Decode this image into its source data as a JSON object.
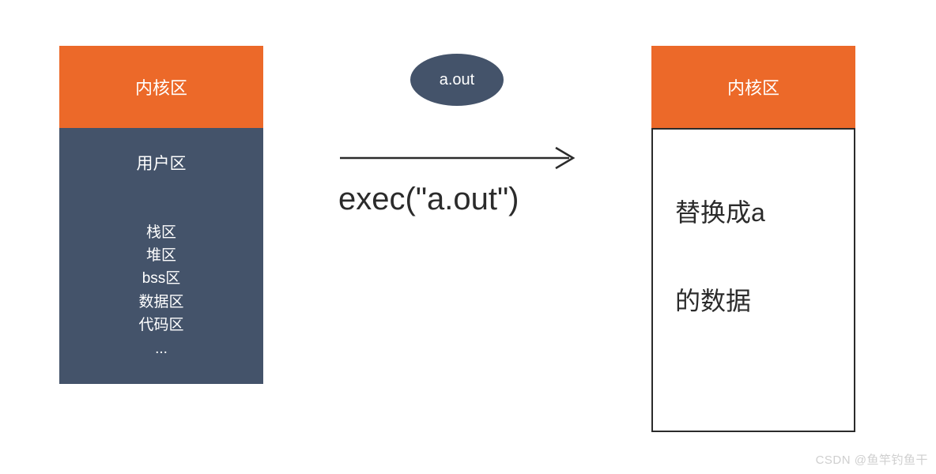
{
  "left": {
    "kernel": "内核区",
    "user_title": "用户区",
    "segments": [
      "栈区",
      "堆区",
      "bss区",
      "数据区",
      "代码区",
      "..."
    ]
  },
  "badge": "a.out",
  "exec": "exec(\"a.out\")",
  "right": {
    "kernel": "内核区",
    "line1": "替换成a",
    "line2": "的数据"
  },
  "watermark": "CSDN @鱼竿钓鱼干"
}
